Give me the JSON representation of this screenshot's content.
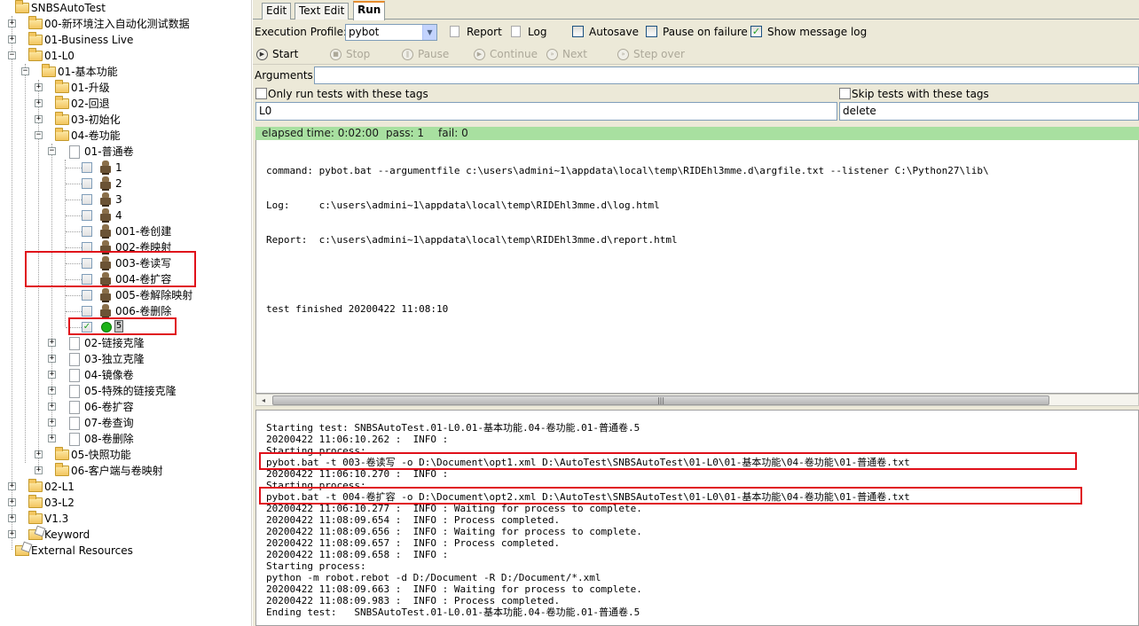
{
  "tree": {
    "root": "SNBSAutoTest",
    "nodes": [
      {
        "label": "00-新环境注入自动化测试数据"
      },
      {
        "label": "01-Business Live"
      },
      {
        "label": "01-L0"
      },
      {
        "label": "01-基本功能"
      },
      {
        "label": "01-升级"
      },
      {
        "label": "02-回退"
      },
      {
        "label": "03-初始化"
      },
      {
        "label": "04-卷功能"
      },
      {
        "label": "01-普通卷"
      },
      {
        "label": "1"
      },
      {
        "label": "2"
      },
      {
        "label": "3"
      },
      {
        "label": "4"
      },
      {
        "label": "001-卷创建"
      },
      {
        "label": "002-卷映射"
      },
      {
        "label": "003-卷读写"
      },
      {
        "label": "004-卷扩容"
      },
      {
        "label": "005-卷解除映射"
      },
      {
        "label": "006-卷删除"
      },
      {
        "label": "5"
      },
      {
        "label": "02-链接克隆"
      },
      {
        "label": "03-独立克隆"
      },
      {
        "label": "04-镜像卷"
      },
      {
        "label": "05-特殊的链接克隆"
      },
      {
        "label": "06-卷扩容"
      },
      {
        "label": "07-卷查询"
      },
      {
        "label": "08-卷删除"
      },
      {
        "label": "05-快照功能"
      },
      {
        "label": "06-客户端与卷映射"
      },
      {
        "label": "02-L1"
      },
      {
        "label": "03-L2"
      },
      {
        "label": "V1.3"
      },
      {
        "label": "Keyword"
      },
      {
        "label": "External Resources"
      }
    ]
  },
  "tabs": {
    "edit": "Edit",
    "text_edit": "Text Edit",
    "run": "Run"
  },
  "exec": {
    "profile_label": "Execution Profile:",
    "profile_value": "pybot",
    "report": "Report",
    "log": "Log",
    "autosave": "Autosave",
    "pause_on_failure": "Pause on failure",
    "show_message_log": "Show message log",
    "checked_mark": "✓"
  },
  "toolbar": {
    "start": "Start",
    "stop": "Stop",
    "pause": "Pause",
    "continue": "Continue",
    "next": "Next",
    "step_over": "Step over"
  },
  "args": {
    "label": "Arguments:",
    "value": ""
  },
  "tags": {
    "only_run_label": "Only run tests with these tags",
    "only_run_value": "L0",
    "skip_label": "Skip tests with these tags",
    "skip_value": "delete"
  },
  "status": {
    "elapsed": "elapsed time: 0:02:00",
    "pass": "pass: 1",
    "fail": "fail: 0"
  },
  "console": {
    "lines": [
      "command: pybot.bat --argumentfile c:\\users\\admini~1\\appdata\\local\\temp\\RIDEhl3mme.d\\argfile.txt --listener C:\\Python27\\lib\\",
      "Log:     c:\\users\\admini~1\\appdata\\local\\temp\\RIDEhl3mme.d\\log.html",
      "Report:  c:\\users\\admini~1\\appdata\\local\\temp\\RIDEhl3mme.d\\report.html",
      "",
      "test finished 20200422 11:08:10"
    ]
  },
  "message_log": {
    "lines": [
      "Starting test: SNBSAutoTest.01-L0.01-基本功能.04-卷功能.01-普通卷.5",
      "20200422 11:06:10.262 :  INFO :",
      "Starting process:",
      "pybot.bat -t 003-卷读写 -o D:\\Document\\opt1.xml D:\\AutoTest\\SNBSAutoTest\\01-L0\\01-基本功能\\04-卷功能\\01-普通卷.txt",
      "20200422 11:06:10.270 :  INFO :",
      "Starting process:",
      "pybot.bat -t 004-卷扩容 -o D:\\Document\\opt2.xml D:\\AutoTest\\SNBSAutoTest\\01-L0\\01-基本功能\\04-卷功能\\01-普通卷.txt",
      "20200422 11:06:10.277 :  INFO : Waiting for process to complete.",
      "20200422 11:08:09.654 :  INFO : Process completed.",
      "20200422 11:08:09.656 :  INFO : Waiting for process to complete.",
      "20200422 11:08:09.657 :  INFO : Process completed.",
      "20200422 11:08:09.658 :  INFO :",
      "Starting process:",
      "python -m robot.rebot -d D:/Document -R D:/Document/*.xml",
      "20200422 11:08:09.663 :  INFO : Waiting for process to complete.",
      "20200422 11:08:09.983 :  INFO : Process completed.",
      "Ending test:   SNBSAutoTest.01-L0.01-基本功能.04-卷功能.01-普通卷.5"
    ]
  },
  "colors": {
    "highlight_box": "#e0101a",
    "status_bar": "#a8e0a0",
    "run_indicator": "#1db318"
  },
  "icons": {
    "expand": "⊞",
    "collapse": "⊟",
    "plus": "+",
    "minus": "−",
    "dropdown": "▼",
    "scroll_left": "◂",
    "scroll_right": "▸",
    "grip": "|||"
  }
}
